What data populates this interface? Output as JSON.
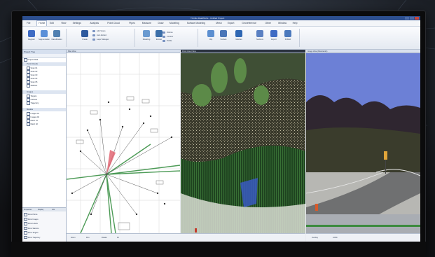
{
  "window": {
    "title": "Trimble RealWorks - Untitled Project"
  },
  "menu_tabs": [
    "File",
    "Home",
    "Edit",
    "View",
    "Settings",
    "Analysis",
    "Point Cloud",
    "Pipes",
    "Measure",
    "Draw",
    "Modeling",
    "Surface Modeling",
    "Mesh",
    "Export",
    "Georeference",
    "Other",
    "Window",
    "Help"
  ],
  "ribbon": {
    "buttons": [
      "Register",
      "Segmentation",
      "Classification",
      "Create",
      "Modeling",
      "Extract",
      "Clip",
      "Surface",
      "Meshes",
      "Sections",
      "Export",
      "Publish"
    ],
    "small_items": [
      "Add Scans",
      "Auto Extract",
      "Layer Manager",
      "Volume",
      "Contour",
      "Profile"
    ]
  },
  "panel": {
    "header": "Project Tree",
    "project_root": "Project Data",
    "groups": [
      "Point Clouds",
      "Images",
      "Models"
    ],
    "tree_items": [
      "Scan 01",
      "Scan 02",
      "Scan 03",
      "Scan 04",
      "Scan 05",
      "Stations",
      "Targets",
      "Camera",
      "Trajectory",
      "Images 01",
      "Images 02",
      "Mesh 01",
      "Mesh 02"
    ],
    "props_tabs": [
      "Properties",
      "Display",
      "Info"
    ],
    "props_rows": [
      "Show Points",
      "Show Images",
      "Show Labels",
      "Show Stations",
      "Show Targets",
      "Show Trajectory"
    ]
  },
  "views": {
    "plan_title": "Plan View",
    "cloud_title": "Point Cloud View",
    "camera_title": "Image View (Panoramic)"
  },
  "status": {
    "left_items": [
      "Zoom",
      "Pan",
      "Rotate",
      "Fit"
    ],
    "right_items": [
      "Overlay",
      "100%"
    ]
  }
}
